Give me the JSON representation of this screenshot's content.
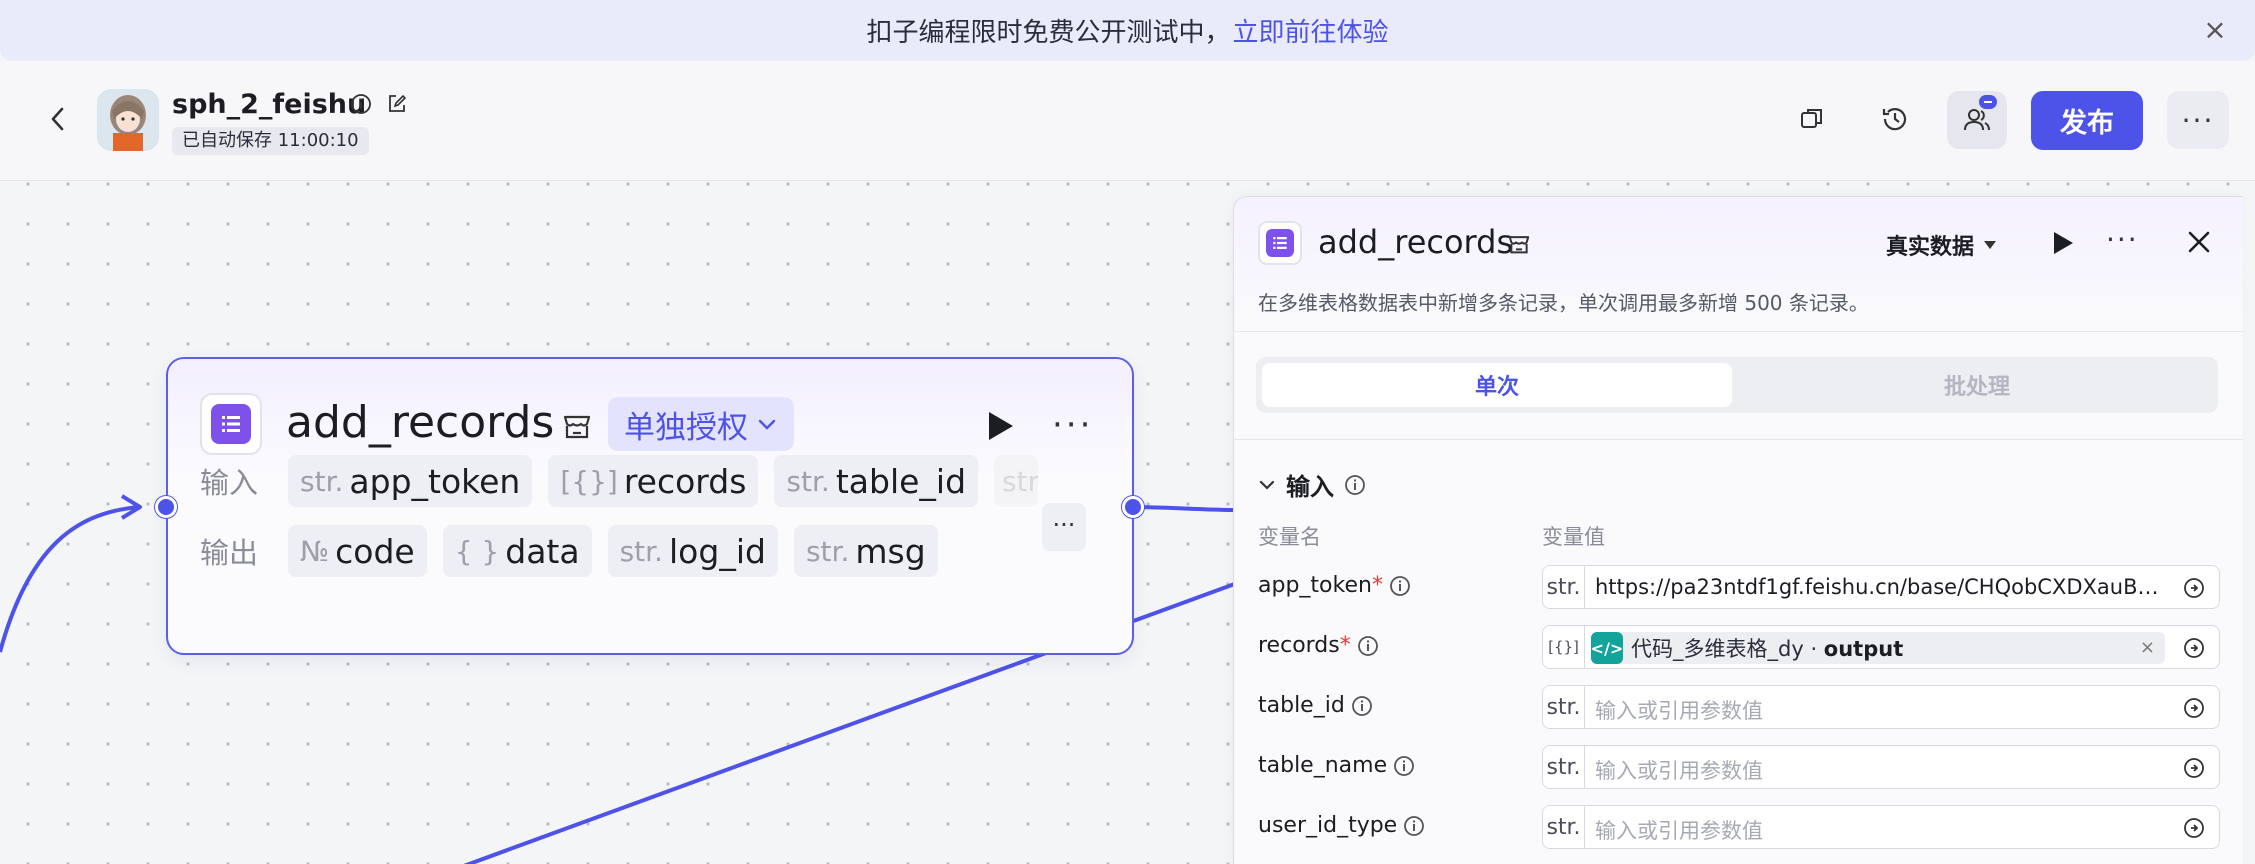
{
  "banner": {
    "text": "扣子编程限时免费公开测试中，",
    "link": "立即前往体验"
  },
  "header": {
    "app_name": "sph_2_feishu",
    "autosave": "已自动保存 11:00:10",
    "publish_label": "发布"
  },
  "node": {
    "title": "add_records",
    "auth_label": "单独授权",
    "input_label": "输入",
    "output_label": "输出",
    "inputs": [
      {
        "type": "str.",
        "name": "app_token"
      },
      {
        "type": "[{}]",
        "name": "records"
      },
      {
        "type": "str.",
        "name": "table_id"
      },
      {
        "type": "str",
        "name": ""
      }
    ],
    "outputs": [
      {
        "type": "№",
        "name": "code"
      },
      {
        "type": "{ }",
        "name": "data"
      },
      {
        "type": "str.",
        "name": "log_id"
      },
      {
        "type": "str.",
        "name": "msg"
      }
    ]
  },
  "panel": {
    "title": "add_records",
    "data_mode": "真实数据",
    "description": "在多维表格数据表中新增多条记录，单次调用最多新增 500 条记录。",
    "tabs": {
      "single": "单次",
      "batch": "批处理"
    },
    "section_title": "输入",
    "col_name": "变量名",
    "col_value": "变量值",
    "params": [
      {
        "name": "app_token",
        "required": "*",
        "type": "str.",
        "value": "https://pa23ntdf1gf.feishu.cn/base/CHQobCXDXauB…",
        "placeholder": ""
      },
      {
        "name": "records",
        "required": "*",
        "type": "[{}]",
        "ref_node": "代码_多维表格_dy",
        "ref_sep": " · ",
        "ref_field": "output"
      },
      {
        "name": "table_id",
        "required": "",
        "type": "str.",
        "value": "",
        "placeholder": "输入或引用参数值"
      },
      {
        "name": "table_name",
        "required": "",
        "type": "str.",
        "value": "",
        "placeholder": "输入或引用参数值"
      },
      {
        "name": "user_id_type",
        "required": "",
        "type": "str.",
        "value": "",
        "placeholder": "输入或引用参数值"
      }
    ]
  },
  "colors": {
    "accent": "#4d53e8",
    "node_icon": "#7e52ea",
    "ref_icon": "#13a39a",
    "required": "#e53935"
  }
}
